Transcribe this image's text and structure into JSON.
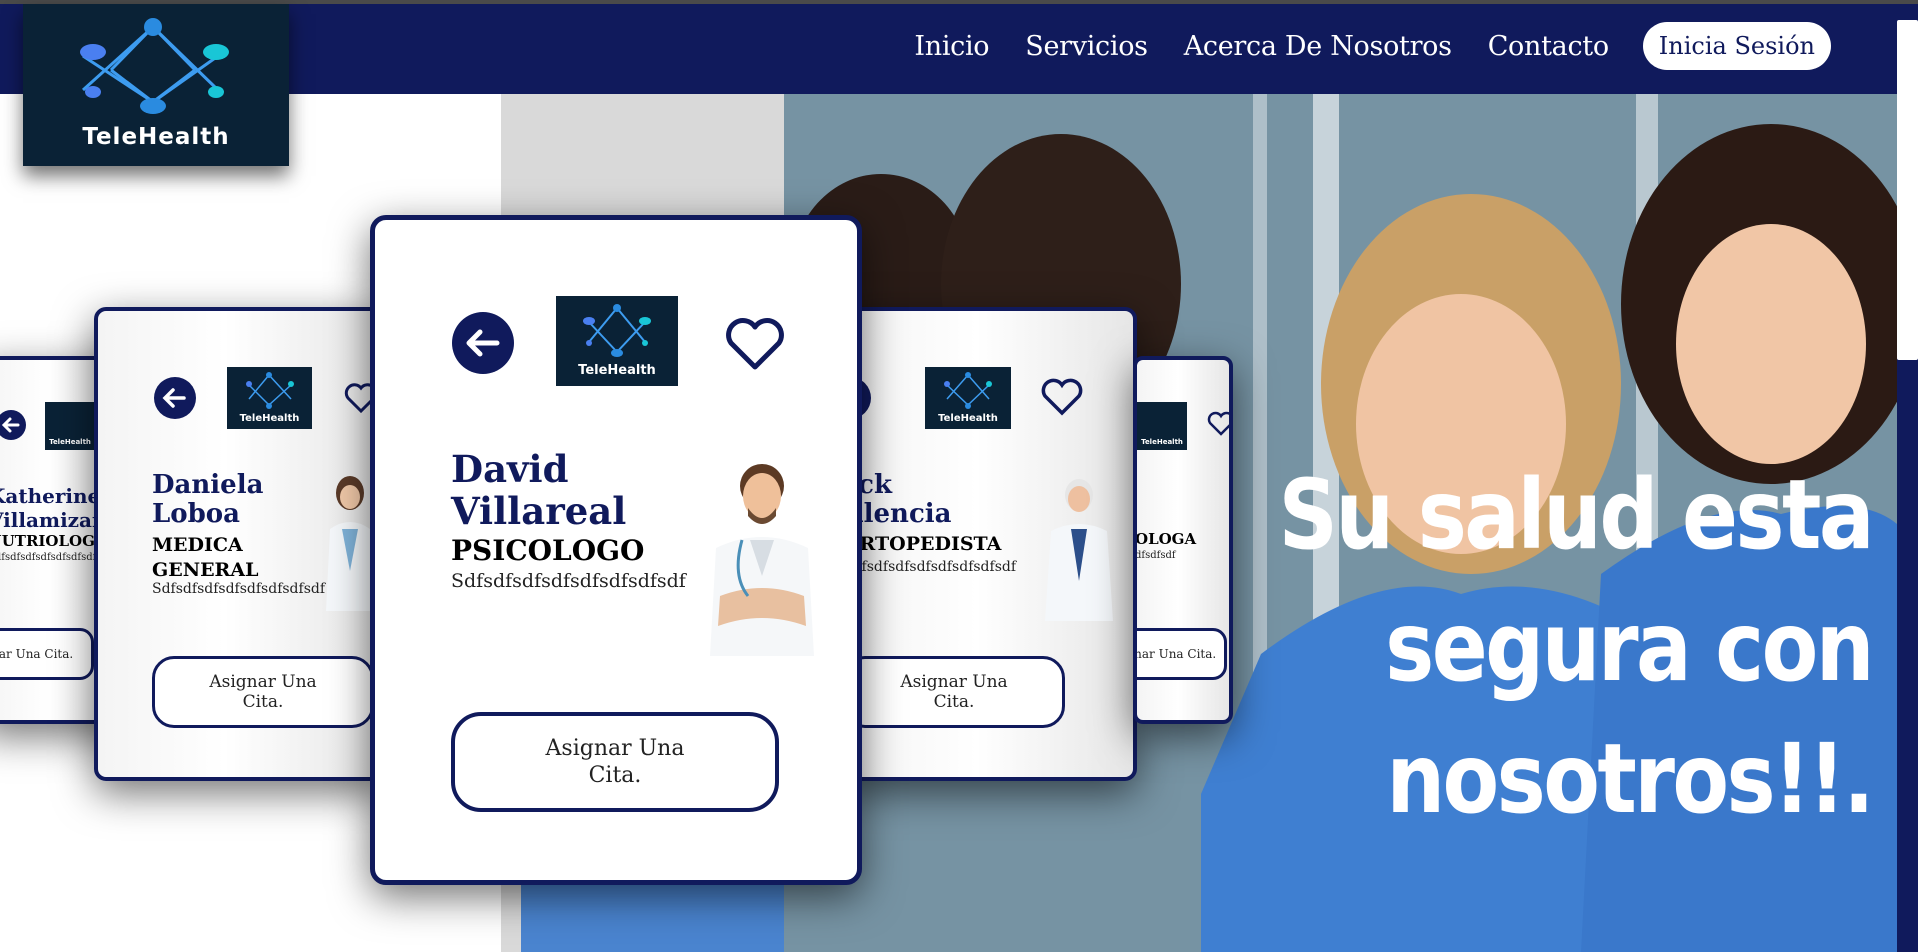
{
  "brand": {
    "name": "TeleHealth"
  },
  "nav": {
    "links": [
      "Inicio",
      "Servicios",
      "Acerca De Nosotros",
      "Contacto"
    ],
    "login": "Inicia Sesión"
  },
  "hero": {
    "line1": "Su salud esta",
    "line2": "segura con",
    "line3": "nosotros!!."
  },
  "cards": [
    {
      "name_1": "Katherine",
      "name_2": "Villamizar",
      "specialty": "NUTRIOLOGA",
      "desc": "Sdfsdfsdfsdfsdfsdfsdfsdf",
      "button": "Asignar Una Cita."
    },
    {
      "name_1": "Daniela",
      "name_2": "Loboa",
      "specialty_1": "MEDICA",
      "specialty_2": "GENERAL",
      "desc": "Sdfsdfsdfsdfsdfsdfsdfsdf",
      "button": "Asignar Una Cita."
    },
    {
      "name_1": "David",
      "name_2": "Villareal",
      "specialty": "PSICOLOGO",
      "desc": "Sdfsdfsdfsdfsdfsdfsdfsdf",
      "button": "Asignar Una Cita."
    },
    {
      "name_1": "Jack",
      "name_2": "Valencia",
      "specialty": "ORTOPEDISTA",
      "desc": "Sdfsdfsdfsdfsdfsdfsdfsdf",
      "button": "Asignar Una Cita."
    },
    {
      "name_1": "",
      "name_2": "",
      "specialty": "OLOGA",
      "desc": "dfsdfsdf",
      "button": "Asignar Una Cita."
    }
  ],
  "colors": {
    "navy": "#101a5c",
    "logo_bg": "#0a2236",
    "scrubs": "#3f7fd1"
  }
}
